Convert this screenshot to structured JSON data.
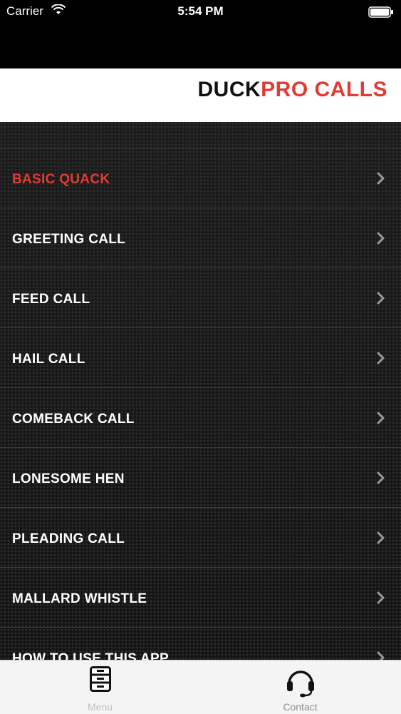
{
  "status_bar": {
    "carrier": "Carrier",
    "time": "5:54 PM",
    "wifi_icon": "wifi-icon",
    "battery_icon": "battery-icon"
  },
  "brand": {
    "part1": "DUCK",
    "part2": "PRO CALLS",
    "color_dark": "#111111",
    "color_accent": "#e23b33"
  },
  "menu": {
    "items": [
      {
        "label": "BASIC QUACK",
        "active": true
      },
      {
        "label": "GREETING CALL"
      },
      {
        "label": "FEED CALL"
      },
      {
        "label": "HAIL CALL"
      },
      {
        "label": "COMEBACK CALL"
      },
      {
        "label": "LONESOME HEN"
      },
      {
        "label": "PLEADING CALL"
      },
      {
        "label": "MALLARD WHISTLE"
      },
      {
        "label": "HOW TO USE THIS APP"
      }
    ],
    "chevron_icon": "chevron-right-icon"
  },
  "tab_bar": {
    "tabs": [
      {
        "label": "Menu",
        "icon": "cabinet-icon",
        "selected": true
      },
      {
        "label": "Contact",
        "icon": "headset-icon"
      }
    ]
  }
}
